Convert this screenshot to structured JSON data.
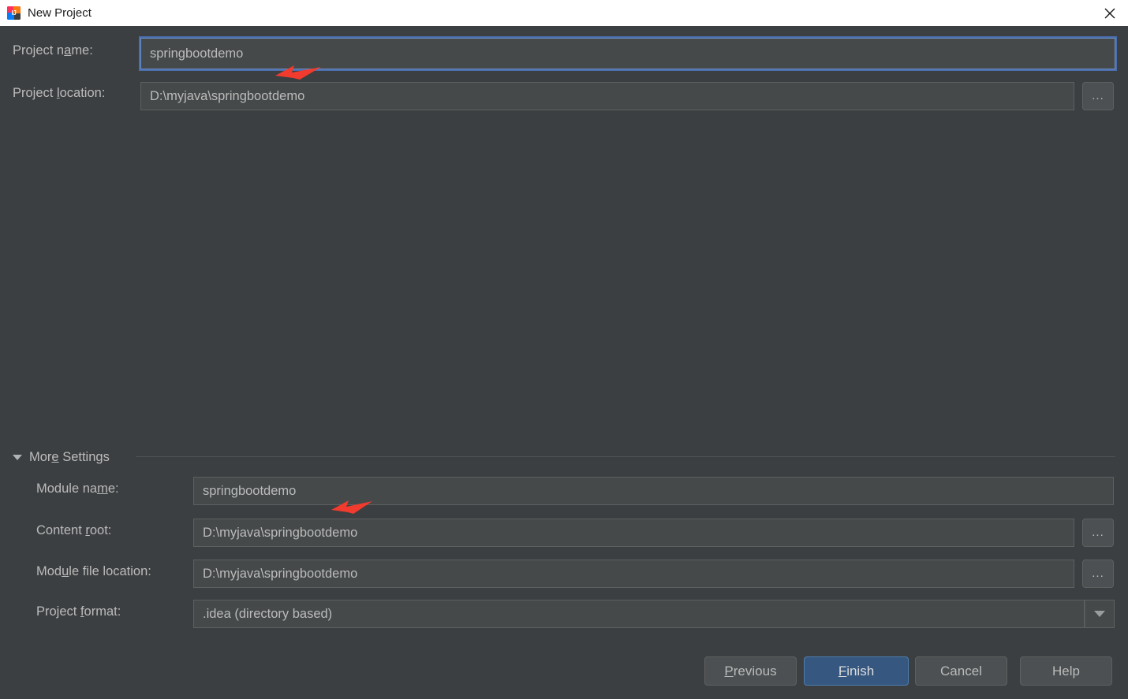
{
  "window": {
    "title": "New Project",
    "app_icon": "intellij-idea-logo",
    "close_icon": "close-icon"
  },
  "form": {
    "project_name": {
      "label_pre": "Project n",
      "label_mnemonic": "a",
      "label_post": "me:",
      "value": "springbootdemo",
      "focused": true
    },
    "project_location": {
      "label_pre": "Project ",
      "label_mnemonic": "l",
      "label_post": "ocation:",
      "value": "D:\\myjava\\springbootdemo",
      "browse_label": "..."
    }
  },
  "more_settings": {
    "label_pre": "Mor",
    "label_mnemonic": "e",
    "label_post": " Settings",
    "expanded": true,
    "toggle_icon": "chevron-down-icon",
    "module_name": {
      "label_pre": "Module na",
      "label_mnemonic": "m",
      "label_post": "e:",
      "value": "springbootdemo"
    },
    "content_root": {
      "label_pre": "Content ",
      "label_mnemonic": "r",
      "label_post": "oot:",
      "value": "D:\\myjava\\springbootdemo",
      "browse_label": "..."
    },
    "module_file_location": {
      "label_pre": "Mod",
      "label_mnemonic": "u",
      "label_post": "le file location:",
      "value": "D:\\myjava\\springbootdemo",
      "browse_label": "..."
    },
    "project_format": {
      "label_pre": "Project ",
      "label_mnemonic": "f",
      "label_post": "ormat:",
      "value": ".idea (directory based)",
      "dropdown_icon": "chevron-down-icon"
    }
  },
  "buttons": {
    "previous": {
      "pre": "",
      "mnemonic": "P",
      "post": "revious"
    },
    "finish": {
      "pre": "",
      "mnemonic": "F",
      "post": "inish",
      "primary": true
    },
    "cancel": {
      "pre": "Cancel",
      "mnemonic": "",
      "post": ""
    },
    "help": {
      "pre": "Help",
      "mnemonic": "",
      "post": ""
    }
  },
  "annotations": {
    "arrow_color": "#f03b2e",
    "arrow_1": "red-arrow-pointing-to-project-name",
    "arrow_2": "red-arrow-pointing-to-module-name"
  },
  "colors": {
    "dialog_background": "#3c3f41",
    "field_background": "#45494a",
    "text": "#bbbbbb",
    "focus_border": "#4b6eaf",
    "primary_button": "#365880",
    "titlebar_background": "#ffffff"
  }
}
